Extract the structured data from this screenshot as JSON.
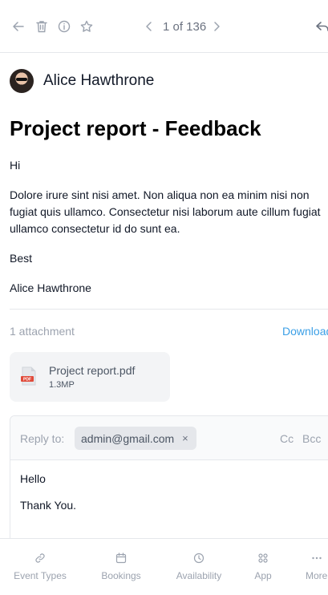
{
  "pager": {
    "text": "1 of 136"
  },
  "sender": {
    "name": "Alice Hawthrone"
  },
  "email": {
    "subject": "Project report - Feedback",
    "greeting": "Hi",
    "body": "Dolore irure sint nisi amet. Non aliqua non ea minim nisi non fugiat quis ullamco. Consectetur nisi laborum aute cillum fugiat ullamco consectetur id do sunt ea.",
    "signoff": "Best",
    "signature": "Alice Hawthrone"
  },
  "attachments": {
    "count_label": "1 attachment",
    "download_label": "Download",
    "file": {
      "name": "Project report.pdf",
      "size": "1.3MP",
      "type_label": "PDF"
    }
  },
  "reply": {
    "label": "Reply to:",
    "recipient": "admin@gmail.com",
    "chip_close": "×",
    "cc": "Cc",
    "bcc": "Bcc",
    "line1": "Hello",
    "line2": "Thank You."
  },
  "nav": {
    "items": [
      {
        "label": "Event Types",
        "icon": "link-icon"
      },
      {
        "label": "Bookings",
        "icon": "calendar-icon"
      },
      {
        "label": "Availability",
        "icon": "clock-icon"
      },
      {
        "label": "App",
        "icon": "grid-icon"
      },
      {
        "label": "More",
        "icon": "more-icon"
      }
    ]
  },
  "colors": {
    "accent_link": "#3b9fe6",
    "pdf_red": "#e04a3a",
    "muted": "#9ca3af"
  }
}
